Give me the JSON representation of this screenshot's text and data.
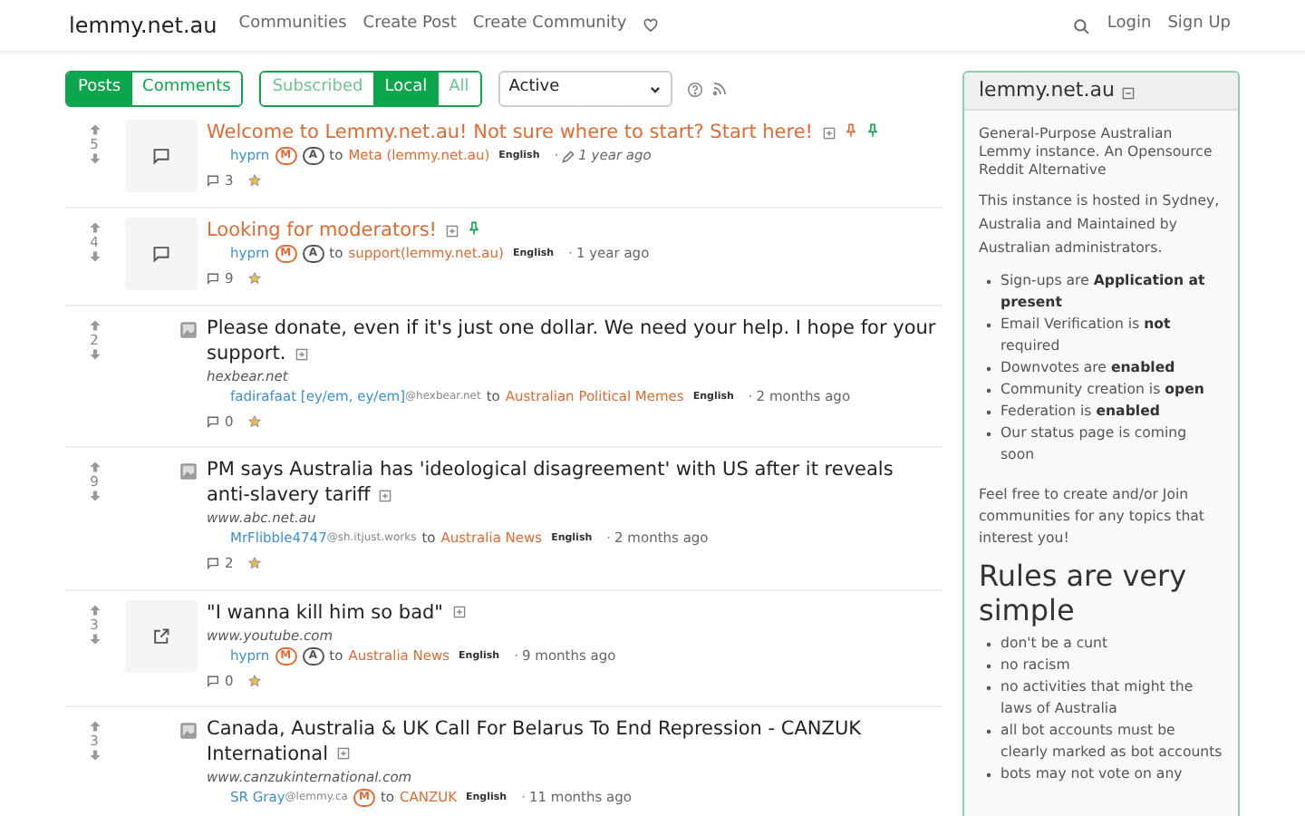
{
  "navbar": {
    "brand": "lemmy.net.au",
    "links": [
      "Communities",
      "Create Post",
      "Create Community"
    ],
    "right_links": [
      "Login",
      "Sign Up"
    ]
  },
  "toolbar": {
    "type_tabs": [
      {
        "label": "Posts",
        "selected": true
      },
      {
        "label": "Comments",
        "selected": false
      }
    ],
    "listing_tabs": [
      {
        "label": "Subscribed",
        "selected": false
      },
      {
        "label": "Local",
        "selected": true
      },
      {
        "label": "All",
        "selected": false
      }
    ],
    "sort": {
      "value": "Active"
    }
  },
  "posts": [
    {
      "score": "5",
      "kind": "text",
      "title": "Welcome to Lemmy.net.au! Not sure where to start? Start here!",
      "featured_local": true,
      "featured_community": true,
      "creator": "hyprn",
      "badges": [
        "M",
        "A"
      ],
      "to_label": "to",
      "community": "Meta (lemmy.net.au)",
      "separator": "·",
      "language": "English",
      "edited": true,
      "time": "1 year ago",
      "comments": "3"
    },
    {
      "score": "4",
      "kind": "text",
      "title": "Looking for moderators!",
      "featured_local": false,
      "featured_community": true,
      "creator": "hyprn",
      "badges": [
        "M",
        "A"
      ],
      "to_label": "to",
      "community": "support(lemmy.net.au)",
      "separator": "·",
      "language": "English",
      "edited": false,
      "time": "1 year ago",
      "comments": "9"
    },
    {
      "score": "2",
      "kind": "link",
      "title": "Please donate, even if it's just one dollar. We need your help. I hope for your support.",
      "featured_local": false,
      "featured_community": false,
      "url": "hexbear.net",
      "creator": "fadirafaat [ey/em, ey/em]",
      "creator_domain": "@hexbear.net",
      "to_label": "to",
      "separator": "·",
      "community": "Australian Political Memes",
      "language": "English",
      "edited": false,
      "time": "2 months ago",
      "comments": "0"
    },
    {
      "score": "9",
      "kind": "link",
      "title": "PM says Australia has 'ideological disagreement' with US after it reveals anti-slavery tariff",
      "featured_local": false,
      "featured_community": false,
      "url": "www.abc.net.au",
      "creator": "MrFlibble4747",
      "creator_domain": "@sh.itjust.works",
      "to_label": "to",
      "separator": "·",
      "community": "Australia News",
      "language": "English",
      "edited": false,
      "time": "2 months ago",
      "comments": "2"
    },
    {
      "score": "3",
      "kind": "external",
      "title": "\"I wanna kill him so bad\"",
      "featured_local": false,
      "featured_community": false,
      "url": "www.youtube.com",
      "creator": "hyprn",
      "badges": [
        "M",
        "A"
      ],
      "to_label": "to",
      "separator": "·",
      "community": "Australia News",
      "language": "English",
      "edited": false,
      "time": "9 months ago",
      "comments": "0"
    },
    {
      "score": "3",
      "kind": "link",
      "title": "Canada, Australia & UK Call For Belarus To End Repression - CANZUK International",
      "featured_local": false,
      "featured_community": false,
      "url": "www.canzukinternational.com",
      "creator": "SR Gray",
      "creator_domain": "@lemmy.ca",
      "badges": [
        "M"
      ],
      "to_label": "to",
      "separator": "·",
      "community": "CANZUK",
      "language": "English",
      "edited": false,
      "time": "11 months ago"
    }
  ],
  "sidebar": {
    "title": "lemmy.net.au",
    "tagline": "General-Purpose Australian Lemmy instance. An Opensource Reddit Alternative",
    "intro": "This instance is hosted in Sydney, Australia and Maintained by Australian administrators.",
    "facts": [
      "Sign-ups are **Application at present**",
      "Email Verification is **not** required",
      "Downvotes are **enabled**",
      "Community creation is **open**",
      "Federation is **enabled**",
      "Our status page is coming soon"
    ],
    "invite": "Feel free to create and/or Join communities for any topics that interest you!",
    "rules_heading": "Rules are very simple",
    "rules": [
      "don't be a cunt",
      "no racism",
      "no activities that might the laws of Australia",
      "all bot accounts must be clearly marked as bot accounts",
      "bots may not vote on any"
    ]
  }
}
